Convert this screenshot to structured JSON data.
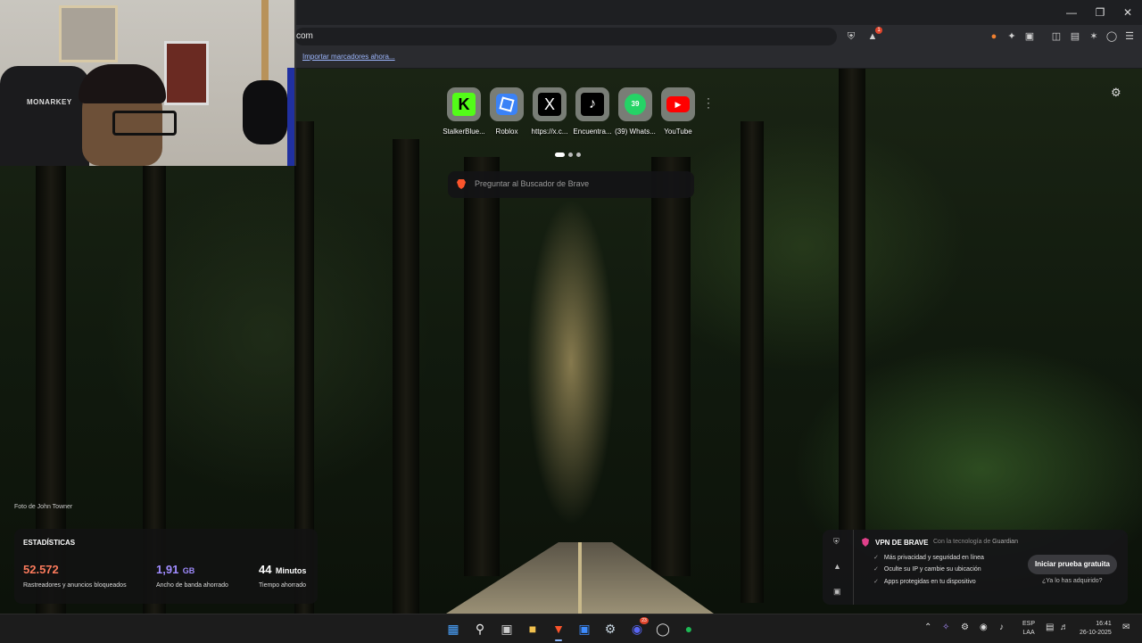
{
  "window": {
    "minimize_icon": "minimize-icon",
    "maximize_icon": "maximize-icon",
    "close_icon": "close-icon"
  },
  "address_bar": {
    "url": "com"
  },
  "bookmarks": {
    "import_link": "Importar marcadores ahora..."
  },
  "shields_badge": "1",
  "topsites": [
    {
      "label": "StalkerBlue...",
      "icon": "kick-icon",
      "color": "#53fc18"
    },
    {
      "label": "Roblox",
      "icon": "roblox-icon",
      "color": "#3b82f6"
    },
    {
      "label": "https://x.c...",
      "icon": "x-icon",
      "color": "#000000"
    },
    {
      "label": "Encuentra...",
      "icon": "tiktok-icon",
      "color": "#000000"
    },
    {
      "label": "(39) Whats...",
      "icon": "whatsapp-icon",
      "color": "#25d366",
      "badge": "39"
    },
    {
      "label": "YouTube",
      "icon": "youtube-icon",
      "color": "#ff0000"
    }
  ],
  "search": {
    "placeholder": "Preguntar al Buscador de Brave"
  },
  "photo_credit": "Foto de John Towner",
  "stats": {
    "title": "ESTADÍSTICAS",
    "blocked_value": "52.572",
    "blocked_label": "Rastreadores y anuncios bloqueados",
    "bandwidth_value": "1,91",
    "bandwidth_unit": "GB",
    "bandwidth_label": "Ancho de banda ahorrado",
    "time_value": "44",
    "time_unit": "Minutos",
    "time_label": "Tiempo ahorrado",
    "colors": {
      "blocked": "#fb7a5c",
      "bandwidth": "#a08cff",
      "time": "#ffffff"
    }
  },
  "vpn": {
    "title": "VPN DE BRAVE",
    "powered_by": "Con la tecnología de",
    "provider": "Guardian",
    "features": [
      "Más privacidad y seguridad en línea",
      "Oculte su IP y cambie su ubicación",
      "Apps protegidas en tu dispositivo"
    ],
    "trial_button": "Iniciar prueba gratuita",
    "already_link": "¿Ya lo has adquirido?"
  },
  "taskbar": {
    "language": "ESP",
    "layout": "LAA",
    "time": "16:41",
    "date": "26-10-2025",
    "discord_badge": "23"
  }
}
